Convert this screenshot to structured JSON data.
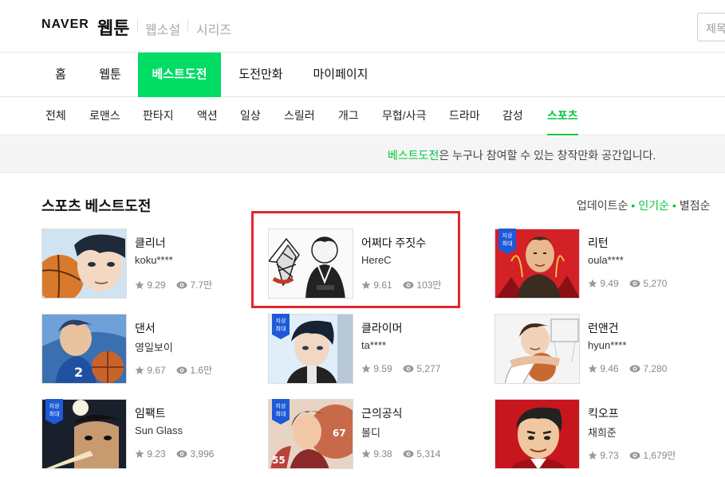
{
  "header": {
    "logo": "NAVER",
    "brand": "웹툰",
    "services": [
      "웹소설",
      "시리즈"
    ],
    "search_placeholder": "제목"
  },
  "main_nav": [
    {
      "label": "홈",
      "active": false
    },
    {
      "label": "웹툰",
      "active": false
    },
    {
      "label": "베스트도전",
      "active": true
    },
    {
      "label": "도전만화",
      "active": false
    },
    {
      "label": "마이페이지",
      "active": false
    }
  ],
  "genres": [
    {
      "label": "전체",
      "active": false
    },
    {
      "label": "로맨스",
      "active": false
    },
    {
      "label": "판타지",
      "active": false
    },
    {
      "label": "액션",
      "active": false
    },
    {
      "label": "일상",
      "active": false
    },
    {
      "label": "스릴러",
      "active": false
    },
    {
      "label": "개그",
      "active": false
    },
    {
      "label": "무협/사극",
      "active": false
    },
    {
      "label": "드라마",
      "active": false
    },
    {
      "label": "감성",
      "active": false
    },
    {
      "label": "스포츠",
      "active": true
    }
  ],
  "notice": {
    "highlight": "베스트도전",
    "text": "은 누구나 참여할 수 있는 창작만화 공간입니다."
  },
  "section": {
    "title": "스포츠 베스트도전",
    "sort_options": [
      {
        "label": "업데이트순",
        "active": false
      },
      {
        "label": "인기순",
        "active": true
      },
      {
        "label": "별점순",
        "active": false
      }
    ]
  },
  "comics": [
    {
      "title": "클리너",
      "author": "koku****",
      "rating": "9.29",
      "views": "7.7만",
      "badge": false,
      "highlighted": false
    },
    {
      "title": "어쩌다 주짓수",
      "author": "HereC",
      "rating": "9.61",
      "views": "103만",
      "badge": false,
      "highlighted": true
    },
    {
      "title": "리턴",
      "author": "oula****",
      "rating": "9.49",
      "views": "5,270",
      "badge": true,
      "highlighted": false
    },
    {
      "title": "댄서",
      "author": "영일보이",
      "rating": "9.67",
      "views": "1.6만",
      "badge": false,
      "highlighted": false
    },
    {
      "title": "클라이머",
      "author": "ta****",
      "rating": "9.59",
      "views": "5,277",
      "badge": true,
      "highlighted": false
    },
    {
      "title": "런앤건",
      "author": "hyun****",
      "rating": "9.46",
      "views": "7,280",
      "badge": false,
      "highlighted": false
    },
    {
      "title": "임팩트",
      "author": "Sun Glass",
      "rating": "9.23",
      "views": "3,996",
      "badge": true,
      "highlighted": false
    },
    {
      "title": "근의공식",
      "author": "볼디",
      "rating": "9.38",
      "views": "5,314",
      "badge": true,
      "highlighted": false
    },
    {
      "title": "킥오프",
      "author": "채희준",
      "rating": "9.73",
      "views": "1,679만",
      "badge": false,
      "highlighted": false
    }
  ],
  "badge_text": [
    "지상",
    "최대"
  ],
  "colors": {
    "accent_green": "#00dc64",
    "text_green": "#00c73c",
    "highlight_red": "#e5252a",
    "badge_blue": "#1e5ad8"
  },
  "icons": [
    "star-icon",
    "eye-icon"
  ]
}
